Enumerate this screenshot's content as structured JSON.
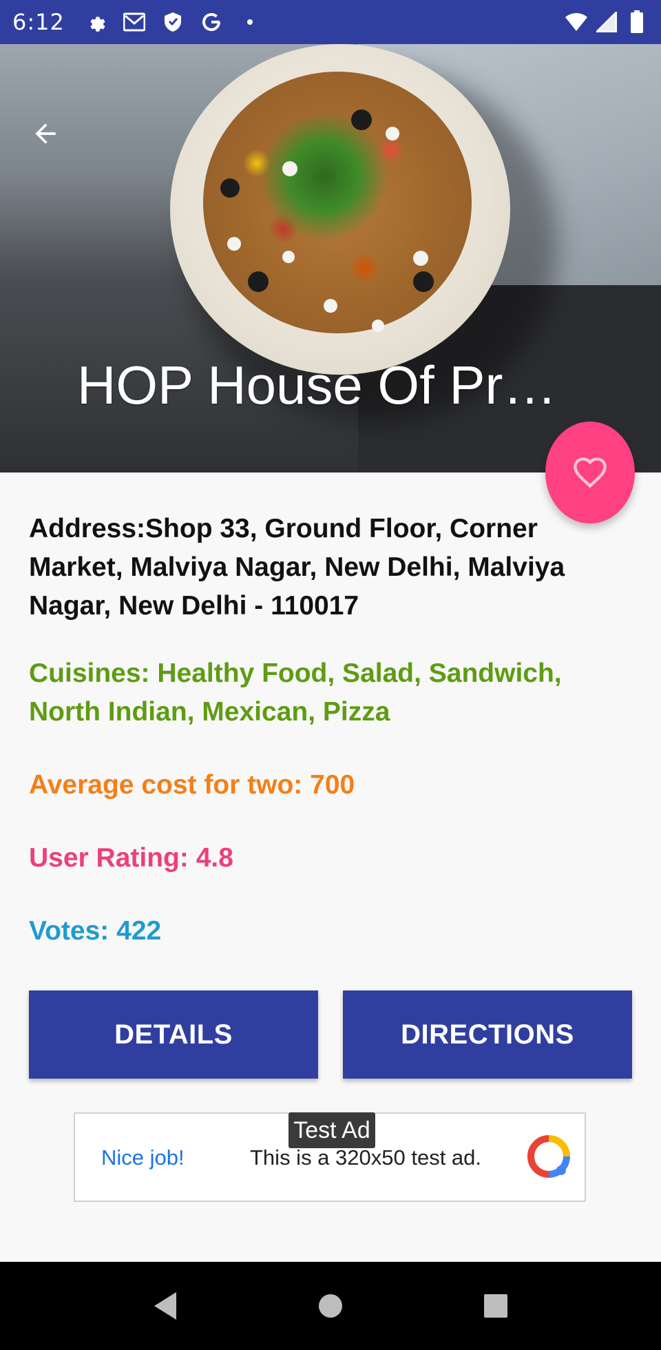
{
  "status_bar": {
    "time": "6:12",
    "left_icons": [
      "settings-icon",
      "gmail-icon",
      "shield-icon",
      "google-g-icon",
      "dot-icon"
    ],
    "right_icons": [
      "wifi-icon",
      "signal-icon",
      "battery-icon"
    ]
  },
  "hero": {
    "title": "HOP House Of Pr…",
    "back_icon": "arrow-back-icon"
  },
  "fab": {
    "icon": "heart-outline-icon"
  },
  "details": {
    "address": "Address:Shop 33, Ground Floor, Corner Market, Malviya Nagar, New Delhi, Malviya Nagar, New Delhi - 110017",
    "cuisines": "Cuisines: Healthy Food, Salad, Sandwich, North Indian, Mexican, Pizza",
    "average_cost": "Average cost for two: 700",
    "user_rating": "User Rating: 4.8",
    "votes": "Votes: 422"
  },
  "buttons": {
    "details_label": "DETAILS",
    "directions_label": "DIRECTIONS"
  },
  "ad": {
    "badge": "Test Ad",
    "nice_job": "Nice job!",
    "text": "This is a 320x50 test ad."
  },
  "nav_bar": {
    "icons": [
      "nav-back-icon",
      "nav-home-icon",
      "nav-recents-icon"
    ]
  },
  "colors": {
    "primary": "#303f9f",
    "accent": "#ff4081",
    "cuisines": "#5e9c12",
    "cost": "#f57f17",
    "rating": "#ec407a",
    "votes": "#1f9bcf"
  }
}
